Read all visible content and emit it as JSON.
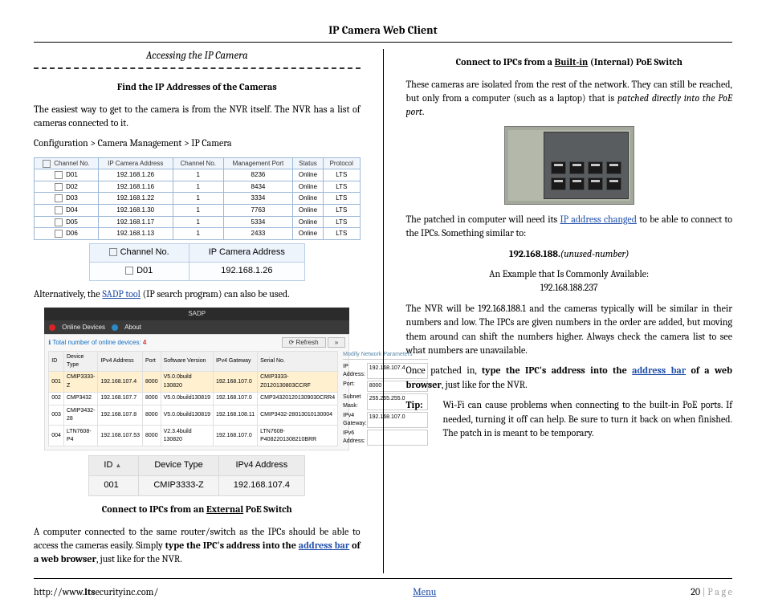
{
  "title": "IP Camera Web Client",
  "left": {
    "access_heading": "Accessing the IP Camera",
    "find_heading": "Find the IP Addresses of the Cameras",
    "intro": "The easiest way to get to the camera is from the NVR itself.  The NVR has a list of cameras connected to it.",
    "path": "Configuration > Camera Management > IP Camera",
    "camlist_headers": [
      "Channel No.",
      "IP Camera Address",
      "Channel No.",
      "Management Port",
      "Status",
      "Protocol"
    ],
    "camlist_rows": [
      [
        "D01",
        "192.168.1.26",
        "1",
        "8236",
        "Online",
        "LTS"
      ],
      [
        "D02",
        "192.168.1.16",
        "1",
        "8434",
        "Online",
        "LTS"
      ],
      [
        "D03",
        "192.168.1.22",
        "1",
        "3334",
        "Online",
        "LTS"
      ],
      [
        "D04",
        "192.168.1.30",
        "1",
        "7763",
        "Online",
        "LTS"
      ],
      [
        "D05",
        "192.168.1.17",
        "1",
        "5334",
        "Online",
        "LTS"
      ],
      [
        "D06",
        "192.168.1.13",
        "1",
        "2433",
        "Online",
        "LTS"
      ]
    ],
    "zoom_headers": [
      "Channel No.",
      "IP Camera Address"
    ],
    "zoom_row": [
      "D01",
      "192.168.1.26"
    ],
    "alt_pre": "Alternatively, the ",
    "alt_link": "SADP tool",
    "alt_post": " (IP search program) can also be used.",
    "sadp": {
      "title": "SADP",
      "online_devices": "Online Devices",
      "about": "About",
      "total_label": "Total number of online devices:",
      "total_count": "4",
      "refresh": "Refresh",
      "headers": [
        "ID",
        "Device Type",
        "IPv4 Address",
        "Port",
        "Software Version",
        "IPv4 Gateway",
        "Serial No."
      ],
      "rows": [
        [
          "001",
          "CMIP3333-Z",
          "192.168.107.4",
          "8000",
          "V5.0.0build 130820",
          "192.168.107.0",
          "CMIP3333-Z0120130803CCRF"
        ],
        [
          "002",
          "CMP3432",
          "192.168.107.7",
          "8000",
          "V5.0.0build130819",
          "192.168.107.0",
          "CMP343201201309030CRR4"
        ],
        [
          "003",
          "CMIP3432-28",
          "192.168.107.8",
          "8000",
          "V5.0.0build130819",
          "192.168.108.11",
          "CMIP3432-28013010130004"
        ],
        [
          "004",
          "LTN7608-P4",
          "192.168.107.53",
          "8000",
          "V2.3.4build 130820",
          "192.168.107.0",
          "LTN7608-P4082201308210BRR"
        ]
      ],
      "side_heading": "Modify Network Parameters",
      "side_rows": [
        [
          "IP Address:",
          "192.168.107.4"
        ],
        [
          "Port:",
          "8000"
        ],
        [
          "Subnet Mask:",
          "255.255.255.0"
        ],
        [
          "IPv4 Gateway:",
          "192.168.107.0"
        ],
        [
          "IPv6 Address:",
          ""
        ]
      ],
      "zoom_headers": [
        "ID",
        "Device Type",
        "IPv4 Address"
      ],
      "zoom_row": [
        "001",
        "CMIP3333-Z",
        "192.168.107.4"
      ]
    },
    "ext_heading_pre": "Connect to IPCs from an ",
    "ext_heading_u": "External",
    "ext_heading_post": " PoE Switch",
    "ext_p_1": "A computer connected to the same router/switch as the IPCs should be able to access the cameras easily.  Simply ",
    "ext_bold_1": "type the IPC's address into the ",
    "ext_link": "address bar",
    "ext_bold_2": " of a web browser",
    "ext_p_end": ", just like for the NVR."
  },
  "right": {
    "heading_pre": "Connect to IPCs from a ",
    "heading_u": "Built‑in",
    "heading_post": " (Internal) PoE Switch",
    "p1_a": "These cameras are isolated from the rest of the network.  They can still be reached, but only from a computer (such as a laptop) that is ",
    "p1_i": "patched directly into the PoE port",
    "p1_b": ".",
    "p2_a": "The patched in computer will need its ",
    "p2_link": "IP address changed",
    "p2_b": " to be able to connect to the IPCs.  Something similar to:",
    "ip_pattern_bold": "192.168.188.",
    "ip_pattern_italic": "(unused‑number)",
    "example_lbl": "An Example that Is Commonly Available:",
    "example_ip": "192.168.188.237",
    "p3": "The NVR will be 192.168.188.1 and the cameras typically will be similar in their numbers and low.  The IPCs are given numbers in the order are added, but moving them around can shift the numbers higher.  Always check the camera list to see what numbers are unavailable.",
    "p4_a": "Once patched in, ",
    "p4_bold1": "type the IPC's address into the ",
    "p4_link": "address bar",
    "p4_bold2": " of a web browser",
    "p4_b": ", just like for the NVR.",
    "tip_lbl": "Tip:",
    "tip_txt": "Wi‑Fi can cause problems when connecting to the built‑in PoE ports.  If needed, turning it off can help.  Be sure to turn it back on when finished.  The patch in is meant to be temporary."
  },
  "footer": {
    "url_pre": "http://www.",
    "url_bold": "lts",
    "url_post": "ecurityinc.com/",
    "menu": "Menu",
    "page_num": "20",
    "page_sep": " | ",
    "page_word": "P a g e"
  }
}
